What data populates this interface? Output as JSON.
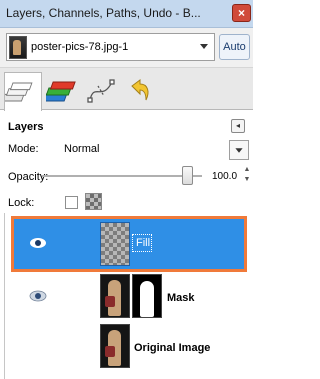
{
  "window": {
    "title": "Layers, Channels, Paths, Undo - B...",
    "close_glyph": "×"
  },
  "image_selector": {
    "value": "poster-pics-78.jpg-1",
    "auto_label": "Auto"
  },
  "tabs": [
    {
      "name": "layers",
      "icon": "layers-icon"
    },
    {
      "name": "channels",
      "icon": "channels-icon"
    },
    {
      "name": "paths",
      "icon": "paths-icon"
    },
    {
      "name": "undo",
      "icon": "undo-icon"
    }
  ],
  "panel": {
    "title": "Layers",
    "menu_glyph": "◂",
    "mode_label": "Mode:",
    "mode_value": "Normal",
    "opacity_label": "Opacity:",
    "opacity_value": "100.0",
    "lock_label": "Lock:"
  },
  "layers": [
    {
      "name": "Fill",
      "visible": true,
      "selected": true
    },
    {
      "name": "Mask",
      "visible": true,
      "selected": false
    },
    {
      "name": "Original Image",
      "visible": false,
      "selected": false
    }
  ],
  "colors": {
    "selection": "#2f8fe6",
    "highlight_outline": "#f07a3a",
    "titlebar": "#c4d8ee"
  }
}
